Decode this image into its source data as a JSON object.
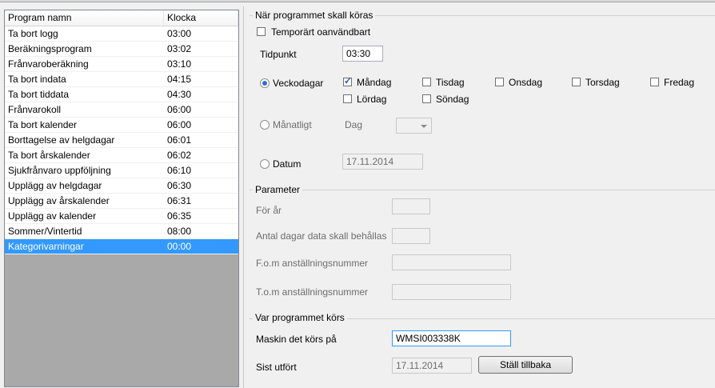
{
  "list": {
    "headers": [
      "Program namn",
      "Klocka"
    ],
    "rows": [
      {
        "name": "Ta bort logg",
        "time": "03:00"
      },
      {
        "name": "Beräkningsprogram",
        "time": "03:02"
      },
      {
        "name": "Frånvaroberäkning",
        "time": "03:10"
      },
      {
        "name": "Ta bort indata",
        "time": "04:15"
      },
      {
        "name": "Ta bort tiddata",
        "time": "04:30"
      },
      {
        "name": "Frånvarokoll",
        "time": "06:00"
      },
      {
        "name": "Ta bort kalender",
        "time": "06:00"
      },
      {
        "name": "Borttagelse av helgdagar",
        "time": "06:01"
      },
      {
        "name": "Ta bort årskalender",
        "time": "06:02"
      },
      {
        "name": "Sjukfrånvaro uppföljning",
        "time": "06:10"
      },
      {
        "name": "Upplägg av helgdagar",
        "time": "06:30"
      },
      {
        "name": "Upplägg av årskalender",
        "time": "06:31"
      },
      {
        "name": "Upplägg av kalender",
        "time": "06:35"
      },
      {
        "name": "Sommer/Vintertid",
        "time": "08:00"
      },
      {
        "name": "Kategorivarningar",
        "time": "00:00"
      }
    ],
    "selected_index": 14
  },
  "schedule": {
    "title": "När programmet skall köras",
    "temp_disabled_label": "Temporärt oanvändbart",
    "time_label": "Tidpunkt",
    "time_value": "03:30",
    "weekly_label": "Veckodagar",
    "days": [
      "Måndag",
      "Tisdag",
      "Onsdag",
      "Torsdag",
      "Fredag",
      "Lördag",
      "Söndag"
    ],
    "checked_days": [
      "Måndag"
    ],
    "monthly_label": "Månatligt",
    "day_label": "Dag",
    "day_value": "",
    "date_label": "Datum",
    "date_value": "17.11.2014",
    "selected_mode": "weekly"
  },
  "params": {
    "title": "Parameter",
    "year_label": "För år",
    "year_value": "",
    "keep_days_label": "Antal dagar data skall behållas",
    "keep_days_value": "",
    "from_emp_label": "F.o.m anställningsnummer",
    "from_emp_value": "",
    "to_emp_label": "T.o.m anställningsnummer",
    "to_emp_value": ""
  },
  "run": {
    "title": "Var programmet körs",
    "machine_label": "Maskin det körs på",
    "machine_value": "WMSI003338K",
    "last_run_label": "Sist utfört",
    "last_run_value": "17.11.2014",
    "reset_button": "Ställ tillbaka"
  },
  "colors": {
    "selection": "#3399ff",
    "list_empty_bg": "#a9a9a9"
  }
}
